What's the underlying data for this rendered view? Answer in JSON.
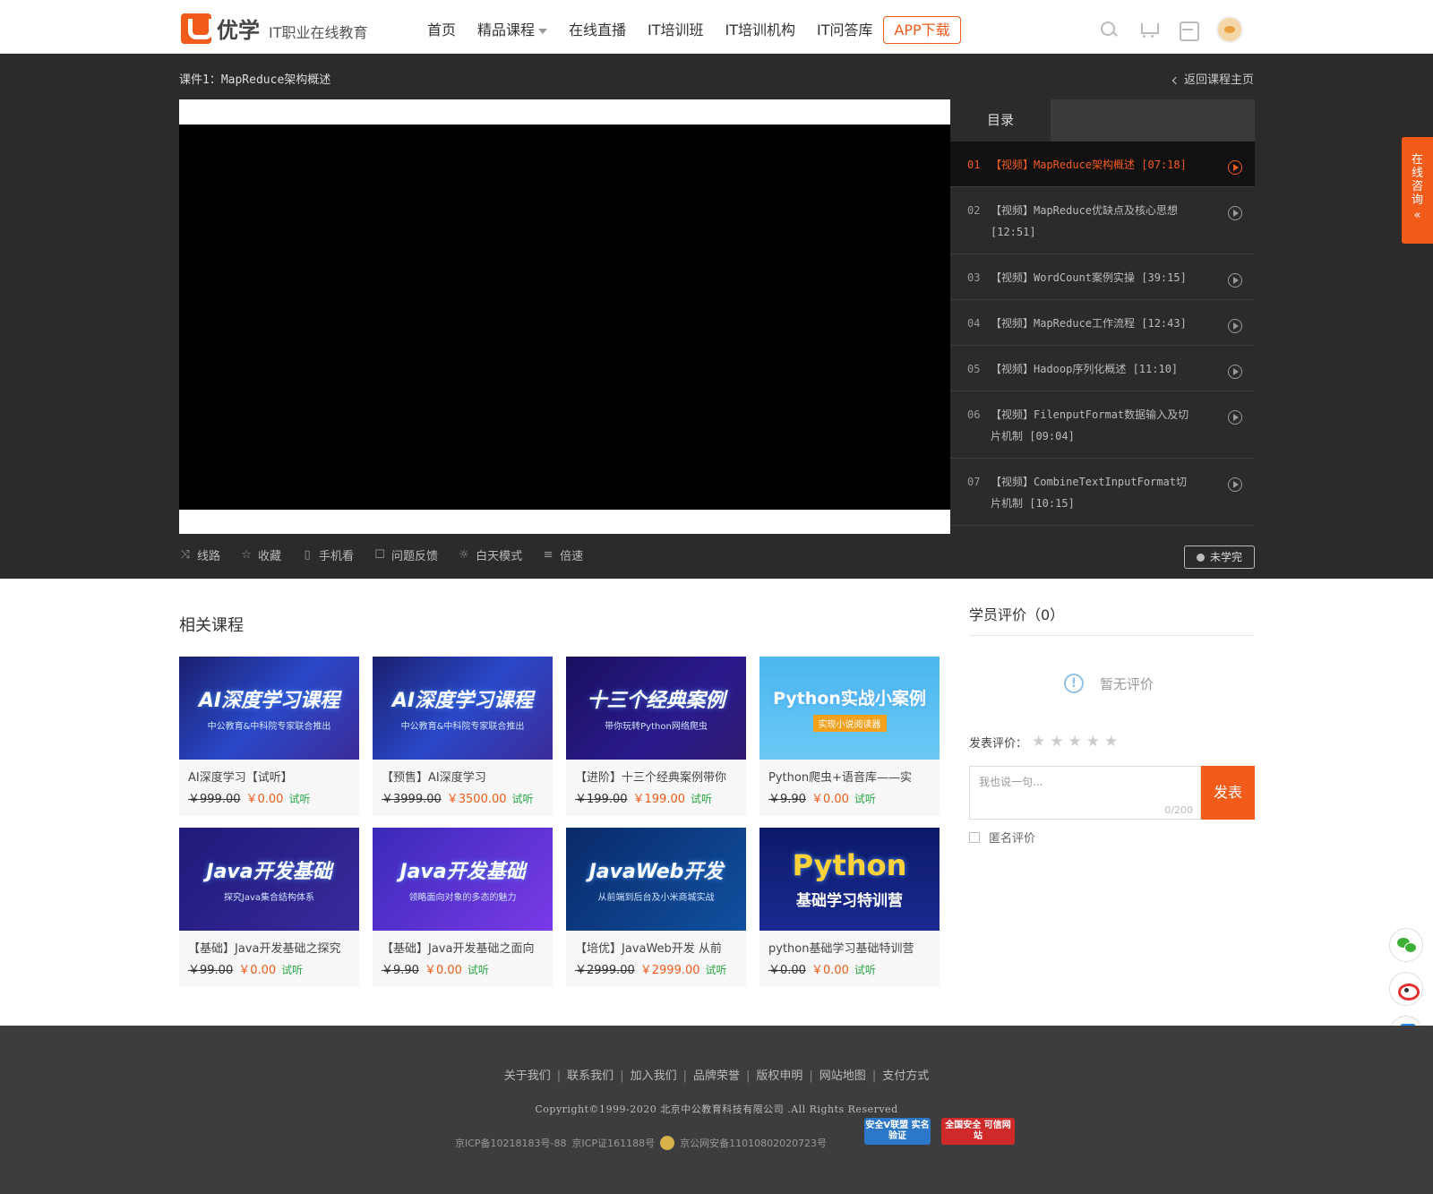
{
  "header": {
    "logo_text": "优学",
    "logo_sub": "IT职业在线教育",
    "nav": [
      "首页",
      "精品课程",
      "在线直播",
      "IT培训班",
      "IT培训机构",
      "IT问答库"
    ],
    "app_button": "APP下载"
  },
  "player": {
    "lesson_title": "课件1：MapReduce架构概述",
    "back_link": "返回课程主页",
    "playlist_tab": "目录",
    "playlist": [
      {
        "num": "01",
        "title": "【视频】MapReduce架构概述 [07:18]",
        "active": true
      },
      {
        "num": "02",
        "title": "【视频】MapReduce优缺点及核心思想 [12:51]",
        "active": false
      },
      {
        "num": "03",
        "title": "【视频】WordCount案例实操 [39:15]",
        "active": false
      },
      {
        "num": "04",
        "title": "【视频】MapReduce工作流程 [12:43]",
        "active": false
      },
      {
        "num": "05",
        "title": "【视频】Hadoop序列化概述 [11:10]",
        "active": false
      },
      {
        "num": "06",
        "title": "【视频】FilenputFormat数据输入及切片机制 [09:04]",
        "active": false
      },
      {
        "num": "07",
        "title": "【视频】CombineTextInputFormat切片机制 [10:15]",
        "active": false
      }
    ],
    "controls": [
      {
        "label": "线路",
        "icon": "shuffle-icon"
      },
      {
        "label": "收藏",
        "icon": "star-icon"
      },
      {
        "label": "手机看",
        "icon": "phone-icon"
      },
      {
        "label": "问题反馈",
        "icon": "feedback-icon"
      },
      {
        "label": "白天模式",
        "icon": "sun-icon"
      },
      {
        "label": "倍速",
        "icon": "speed-icon"
      }
    ],
    "status": "未学完"
  },
  "related": {
    "title": "相关课程",
    "courses": [
      {
        "thumb_h": "AI深度学习课程",
        "thumb_s": "中公教育&中科院专家联合推出",
        "style": "ai",
        "name": "AI深度学习【试听】",
        "orig": "￥999.00",
        "now": "￥0.00",
        "tag": "试听"
      },
      {
        "thumb_h": "AI深度学习课程",
        "thumb_s": "中公教育&中科院专家联合推出",
        "style": "ai",
        "name": "【预售】AI深度学习",
        "orig": "￥3999.00",
        "now": "￥3500.00",
        "tag": "试听"
      },
      {
        "thumb_h": "十三个经典案例",
        "thumb_s": "带你玩转Python网络爬虫",
        "style": "classic",
        "name": "【进阶】十三个经典案例带你",
        "orig": "￥199.00",
        "now": "￥199.00",
        "tag": "试听"
      },
      {
        "thumb_h": "Python实战小案例",
        "thumb_s": "实现小说阅读器",
        "style": "pyshow",
        "name": "Python爬虫+语音库——实",
        "orig": "￥9.90",
        "now": "￥0.00",
        "tag": "试听"
      },
      {
        "thumb_h": "Java开发基础",
        "thumb_s": "探究Java集合结构体系",
        "style": "java1",
        "name": "【基础】Java开发基础之探究",
        "orig": "￥99.00",
        "now": "￥0.00",
        "tag": "试听"
      },
      {
        "thumb_h": "Java开发基础",
        "thumb_s": "领略面向对象的多态的魅力",
        "style": "java2",
        "name": "【基础】Java开发基础之面向",
        "orig": "￥9.90",
        "now": "￥0.00",
        "tag": "试听"
      },
      {
        "thumb_h": "JavaWeb开发",
        "thumb_s": "从前端到后台及小米商城实战",
        "style": "jweb",
        "name": "【培优】JavaWeb开发 从前",
        "orig": "￥2999.00",
        "now": "￥2999.00",
        "tag": "试听"
      },
      {
        "thumb_h": "Python",
        "thumb_s": "基础学习特训营",
        "style": "pybase",
        "name": "python基础学习基础特训营",
        "orig": "￥0.00",
        "now": "￥0.00",
        "tag": "试听"
      }
    ]
  },
  "reviews": {
    "title": "学员评价（0）",
    "empty": "暂无评价",
    "rate_label": "发表评价：",
    "placeholder": "我也说一句...",
    "counter": "0/200",
    "submit": "发表",
    "anonymous": "匿名评价"
  },
  "floating": {
    "consult": "在线咨询"
  },
  "footer": {
    "links": [
      "关于我们",
      "联系我们",
      "加入我们",
      "品牌荣誉",
      "版权申明",
      "网站地图",
      "支付方式"
    ],
    "copyright": "Copyright©1999-2020 北京中公教育科技有限公司 .All Rights Reserved",
    "icp1": "京ICP备10218183号-88",
    "icp2": "京ICP证161188号",
    "icp3": "京公网安备11010802020723号",
    "badge_blue": "安全V联盟 实名验证",
    "badge_red": "全国安全 可信网站"
  },
  "colors": {
    "accent": "#f35b1b",
    "dark_band": "#2b2b2b",
    "footer": "#3d3d3f",
    "trial_green": "#29a744"
  }
}
